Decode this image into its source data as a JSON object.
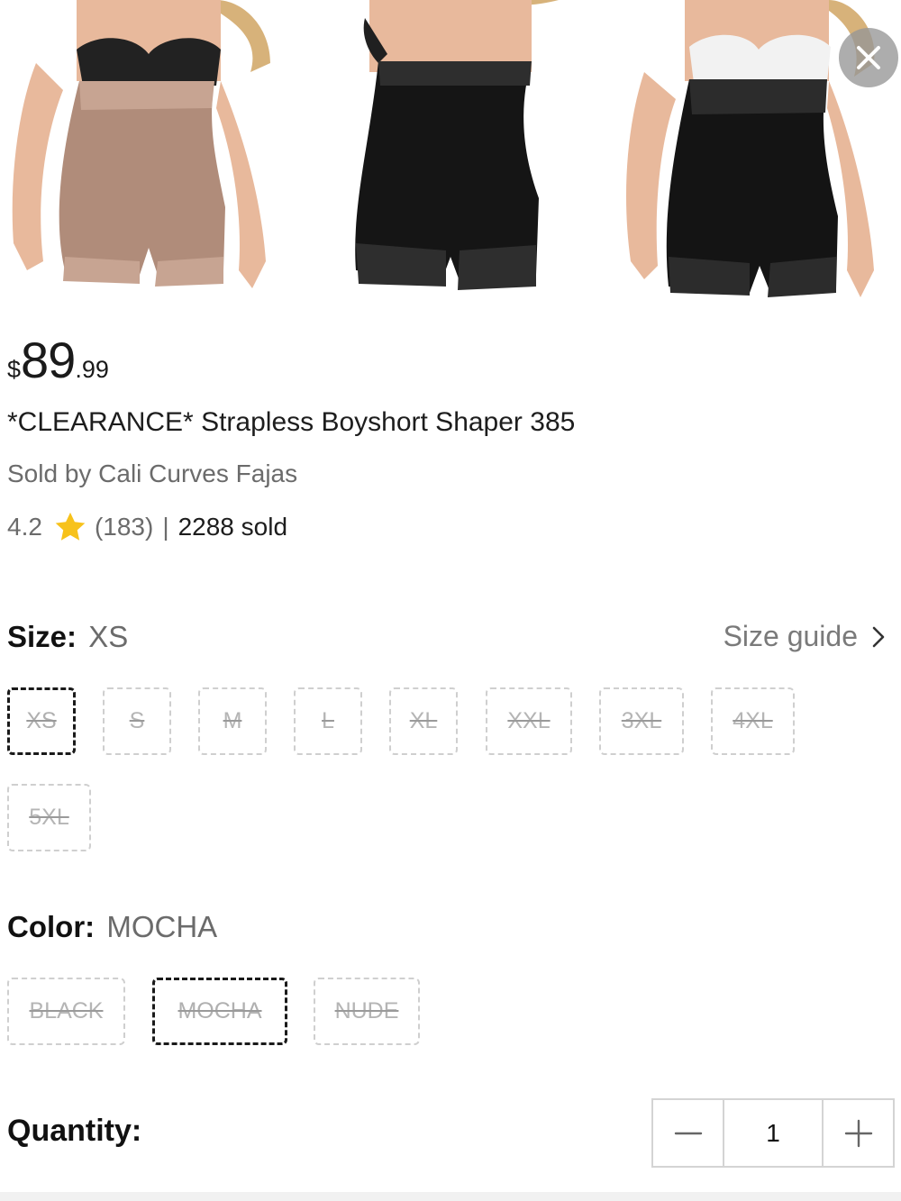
{
  "gallery": {
    "images": [
      {
        "alt": "mocha-boyshort-shaper-front",
        "garment_color": "#b08c7a",
        "lace_color": "#c7a492",
        "bra_color": "#222222"
      },
      {
        "alt": "black-boyshort-shaper-back",
        "garment_color": "#151515",
        "lace_color": "#2e2e2e",
        "bra_color": "#202020"
      },
      {
        "alt": "black-boyshort-shaper-front",
        "garment_color": "#141414",
        "lace_color": "#2c2c2c",
        "bra_color": "#f2f2f2"
      }
    ],
    "close_icon": "close-icon"
  },
  "product": {
    "price_currency": "$",
    "price_whole": "89",
    "price_cents": ".99",
    "title": "*CLEARANCE* Strapless Boyshort Shaper 385",
    "seller": "Sold by Cali Curves Fajas",
    "rating": "4.2",
    "rating_icon": "star-icon",
    "review_count": "(183)",
    "separator": "|",
    "sold": "2288 sold"
  },
  "size": {
    "label": "Size:",
    "selected": "XS",
    "guide_label": "Size guide",
    "options": [
      "XS",
      "S",
      "M",
      "L",
      "XL",
      "XXL",
      "3XL",
      "4XL",
      "5XL"
    ]
  },
  "color": {
    "label": "Color:",
    "selected": "MOCHA",
    "options": [
      "BLACK",
      "MOCHA",
      "NUDE"
    ]
  },
  "quantity": {
    "label": "Quantity:",
    "value": "1",
    "decrement_icon": "minus-icon",
    "increment_icon": "plus-icon"
  },
  "colors": {
    "star": "#f7c21b",
    "chip_border": "#cfcfcf",
    "selected_border": "#1a1a1a",
    "muted_text": "#6b6b6b"
  }
}
